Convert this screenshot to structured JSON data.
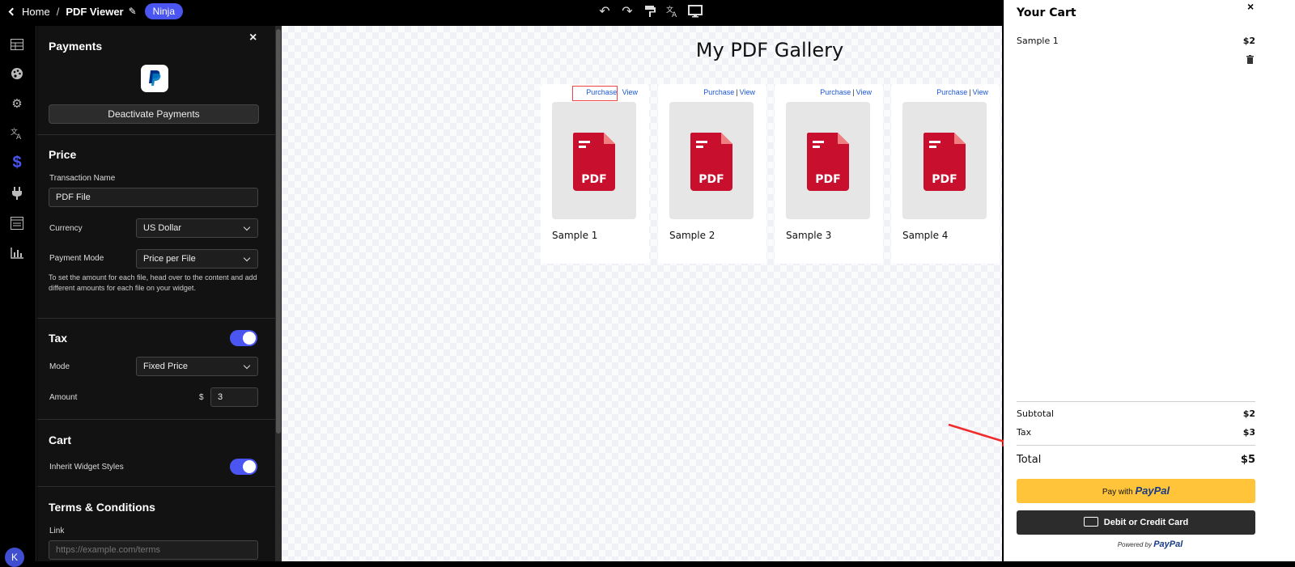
{
  "topbar": {
    "home_label": "Home",
    "separator": "/",
    "title": "PDF Viewer",
    "badge": "Ninja",
    "tools": [
      "undo-icon",
      "redo-icon",
      "paint-roller-icon",
      "translate-icon",
      "monitor-icon"
    ]
  },
  "rail": {
    "items": [
      "table-icon",
      "palette-icon",
      "gear-icon",
      "translate-icon",
      "dollar-icon",
      "plug-icon",
      "form-icon",
      "chart-icon"
    ],
    "active": "dollar-icon",
    "avatar": "K"
  },
  "panel": {
    "close": "×",
    "payments": {
      "title": "Payments",
      "deactivate_label": "Deactivate Payments"
    },
    "price": {
      "title": "Price",
      "transaction_name_label": "Transaction Name",
      "transaction_name_value": "PDF File",
      "currency_label": "Currency",
      "currency_value": "US Dollar",
      "payment_mode_label": "Payment Mode",
      "payment_mode_value": "Price per File",
      "hint": "To set the amount for each file, head over to the content and add different amounts for each file on your widget."
    },
    "tax": {
      "title": "Tax",
      "enabled": true,
      "mode_label": "Mode",
      "mode_value": "Fixed Price",
      "amount_label": "Amount",
      "currency_symbol": "$",
      "amount_value": "3"
    },
    "cart": {
      "title": "Cart",
      "inherit_label": "Inherit Widget Styles",
      "inherit_enabled": true
    },
    "terms": {
      "title": "Terms & Conditions",
      "link_label": "Link",
      "link_placeholder": "https://example.com/terms"
    }
  },
  "gallery": {
    "title": "My PDF Gallery",
    "purchase_label": "Purchase",
    "view_label": "View",
    "link_separator": "|",
    "pdf_label": "PDF",
    "items": [
      {
        "name": "Sample 1"
      },
      {
        "name": "Sample 2"
      },
      {
        "name": "Sample 3"
      },
      {
        "name": "Sample 4"
      }
    ]
  },
  "cart": {
    "title": "Your Cart",
    "close": "×",
    "items": [
      {
        "name": "Sample 1",
        "price": "$2"
      }
    ],
    "subtotal_label": "Subtotal",
    "subtotal_value": "$2",
    "tax_label": "Tax",
    "tax_value": "$3",
    "total_label": "Total",
    "total_value": "$5",
    "paypal_prefix": "Pay with",
    "paypal_brand": "PayPal",
    "card_label": "Debit or Credit Card",
    "powered_prefix": "Powered by",
    "powered_brand": "PayPal"
  },
  "colors": {
    "accent": "#4b56f2",
    "pdf_red": "#c8102e",
    "paypal_yellow": "#ffc43a",
    "annotation_red": "#ef2b2b"
  }
}
